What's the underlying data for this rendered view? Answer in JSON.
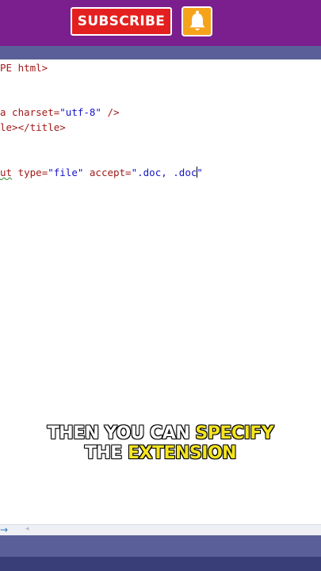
{
  "banner": {
    "subscribe_label": "SUBSCRIBE",
    "bell_icon": "bell-icon",
    "colors": {
      "background": "#7b1f8e",
      "subscribe": "#e41f1f",
      "bell": "#f5a31b"
    }
  },
  "editor": {
    "lines": [
      {
        "parts": [
          "PE html>"
        ]
      },
      {
        "parts": [
          "a charset=",
          "\"utf-8\"",
          " />"
        ]
      },
      {
        "parts": [
          "le></title>"
        ]
      },
      {
        "parts": [
          "ut",
          " type=",
          "\"file\"",
          " accept=",
          "\".doc, .doc",
          "\""
        ]
      }
    ]
  },
  "caption": {
    "line1_plain": "THEN YOU CAN ",
    "line1_highlight": "SPECIFY",
    "line2_plain": "THE ",
    "line2_highlight": "EXTENSION"
  },
  "scrollbar": {
    "right_arrow": "→",
    "left_arrow": "◂"
  }
}
